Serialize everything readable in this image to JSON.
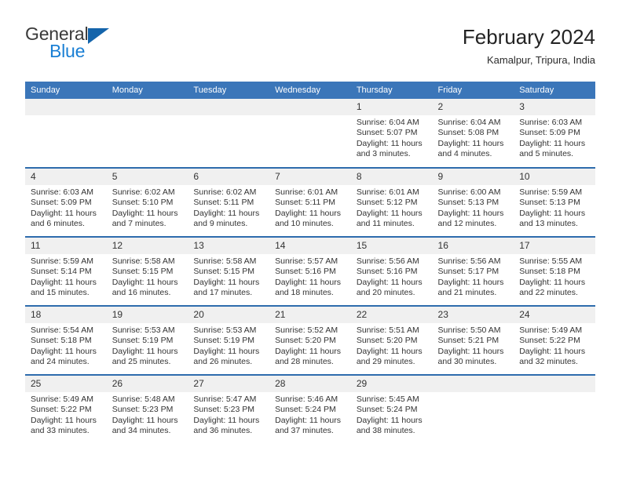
{
  "brand": {
    "name_part1": "General",
    "name_part2": "Blue",
    "triangle_color": "#1464ab",
    "blue_color": "#1a7fd4"
  },
  "header": {
    "title": "February 2024",
    "location": "Kamalpur, Tripura, India"
  },
  "theme": {
    "header_blue": "#3b76b9",
    "row_divider_blue": "#2e6cad",
    "daynum_band": "#f0f0f0"
  },
  "weekday_headers": [
    "Sunday",
    "Monday",
    "Tuesday",
    "Wednesday",
    "Thursday",
    "Friday",
    "Saturday"
  ],
  "weeks": [
    [
      {
        "day": "",
        "sunrise": "",
        "sunset": "",
        "daylight": "",
        "empty": true
      },
      {
        "day": "",
        "sunrise": "",
        "sunset": "",
        "daylight": "",
        "empty": true
      },
      {
        "day": "",
        "sunrise": "",
        "sunset": "",
        "daylight": "",
        "empty": true
      },
      {
        "day": "",
        "sunrise": "",
        "sunset": "",
        "daylight": "",
        "empty": true
      },
      {
        "day": "1",
        "sunrise": "Sunrise: 6:04 AM",
        "sunset": "Sunset: 5:07 PM",
        "daylight": "Daylight: 11 hours and 3 minutes."
      },
      {
        "day": "2",
        "sunrise": "Sunrise: 6:04 AM",
        "sunset": "Sunset: 5:08 PM",
        "daylight": "Daylight: 11 hours and 4 minutes."
      },
      {
        "day": "3",
        "sunrise": "Sunrise: 6:03 AM",
        "sunset": "Sunset: 5:09 PM",
        "daylight": "Daylight: 11 hours and 5 minutes."
      }
    ],
    [
      {
        "day": "4",
        "sunrise": "Sunrise: 6:03 AM",
        "sunset": "Sunset: 5:09 PM",
        "daylight": "Daylight: 11 hours and 6 minutes."
      },
      {
        "day": "5",
        "sunrise": "Sunrise: 6:02 AM",
        "sunset": "Sunset: 5:10 PM",
        "daylight": "Daylight: 11 hours and 7 minutes."
      },
      {
        "day": "6",
        "sunrise": "Sunrise: 6:02 AM",
        "sunset": "Sunset: 5:11 PM",
        "daylight": "Daylight: 11 hours and 9 minutes."
      },
      {
        "day": "7",
        "sunrise": "Sunrise: 6:01 AM",
        "sunset": "Sunset: 5:11 PM",
        "daylight": "Daylight: 11 hours and 10 minutes."
      },
      {
        "day": "8",
        "sunrise": "Sunrise: 6:01 AM",
        "sunset": "Sunset: 5:12 PM",
        "daylight": "Daylight: 11 hours and 11 minutes."
      },
      {
        "day": "9",
        "sunrise": "Sunrise: 6:00 AM",
        "sunset": "Sunset: 5:13 PM",
        "daylight": "Daylight: 11 hours and 12 minutes."
      },
      {
        "day": "10",
        "sunrise": "Sunrise: 5:59 AM",
        "sunset": "Sunset: 5:13 PM",
        "daylight": "Daylight: 11 hours and 13 minutes."
      }
    ],
    [
      {
        "day": "11",
        "sunrise": "Sunrise: 5:59 AM",
        "sunset": "Sunset: 5:14 PM",
        "daylight": "Daylight: 11 hours and 15 minutes."
      },
      {
        "day": "12",
        "sunrise": "Sunrise: 5:58 AM",
        "sunset": "Sunset: 5:15 PM",
        "daylight": "Daylight: 11 hours and 16 minutes."
      },
      {
        "day": "13",
        "sunrise": "Sunrise: 5:58 AM",
        "sunset": "Sunset: 5:15 PM",
        "daylight": "Daylight: 11 hours and 17 minutes."
      },
      {
        "day": "14",
        "sunrise": "Sunrise: 5:57 AM",
        "sunset": "Sunset: 5:16 PM",
        "daylight": "Daylight: 11 hours and 18 minutes."
      },
      {
        "day": "15",
        "sunrise": "Sunrise: 5:56 AM",
        "sunset": "Sunset: 5:16 PM",
        "daylight": "Daylight: 11 hours and 20 minutes."
      },
      {
        "day": "16",
        "sunrise": "Sunrise: 5:56 AM",
        "sunset": "Sunset: 5:17 PM",
        "daylight": "Daylight: 11 hours and 21 minutes."
      },
      {
        "day": "17",
        "sunrise": "Sunrise: 5:55 AM",
        "sunset": "Sunset: 5:18 PM",
        "daylight": "Daylight: 11 hours and 22 minutes."
      }
    ],
    [
      {
        "day": "18",
        "sunrise": "Sunrise: 5:54 AM",
        "sunset": "Sunset: 5:18 PM",
        "daylight": "Daylight: 11 hours and 24 minutes."
      },
      {
        "day": "19",
        "sunrise": "Sunrise: 5:53 AM",
        "sunset": "Sunset: 5:19 PM",
        "daylight": "Daylight: 11 hours and 25 minutes."
      },
      {
        "day": "20",
        "sunrise": "Sunrise: 5:53 AM",
        "sunset": "Sunset: 5:19 PM",
        "daylight": "Daylight: 11 hours and 26 minutes."
      },
      {
        "day": "21",
        "sunrise": "Sunrise: 5:52 AM",
        "sunset": "Sunset: 5:20 PM",
        "daylight": "Daylight: 11 hours and 28 minutes."
      },
      {
        "day": "22",
        "sunrise": "Sunrise: 5:51 AM",
        "sunset": "Sunset: 5:20 PM",
        "daylight": "Daylight: 11 hours and 29 minutes."
      },
      {
        "day": "23",
        "sunrise": "Sunrise: 5:50 AM",
        "sunset": "Sunset: 5:21 PM",
        "daylight": "Daylight: 11 hours and 30 minutes."
      },
      {
        "day": "24",
        "sunrise": "Sunrise: 5:49 AM",
        "sunset": "Sunset: 5:22 PM",
        "daylight": "Daylight: 11 hours and 32 minutes."
      }
    ],
    [
      {
        "day": "25",
        "sunrise": "Sunrise: 5:49 AM",
        "sunset": "Sunset: 5:22 PM",
        "daylight": "Daylight: 11 hours and 33 minutes."
      },
      {
        "day": "26",
        "sunrise": "Sunrise: 5:48 AM",
        "sunset": "Sunset: 5:23 PM",
        "daylight": "Daylight: 11 hours and 34 minutes."
      },
      {
        "day": "27",
        "sunrise": "Sunrise: 5:47 AM",
        "sunset": "Sunset: 5:23 PM",
        "daylight": "Daylight: 11 hours and 36 minutes."
      },
      {
        "day": "28",
        "sunrise": "Sunrise: 5:46 AM",
        "sunset": "Sunset: 5:24 PM",
        "daylight": "Daylight: 11 hours and 37 minutes."
      },
      {
        "day": "29",
        "sunrise": "Sunrise: 5:45 AM",
        "sunset": "Sunset: 5:24 PM",
        "daylight": "Daylight: 11 hours and 38 minutes."
      },
      {
        "day": "",
        "sunrise": "",
        "sunset": "",
        "daylight": "",
        "empty": true
      },
      {
        "day": "",
        "sunrise": "",
        "sunset": "",
        "daylight": "",
        "empty": true
      }
    ]
  ]
}
